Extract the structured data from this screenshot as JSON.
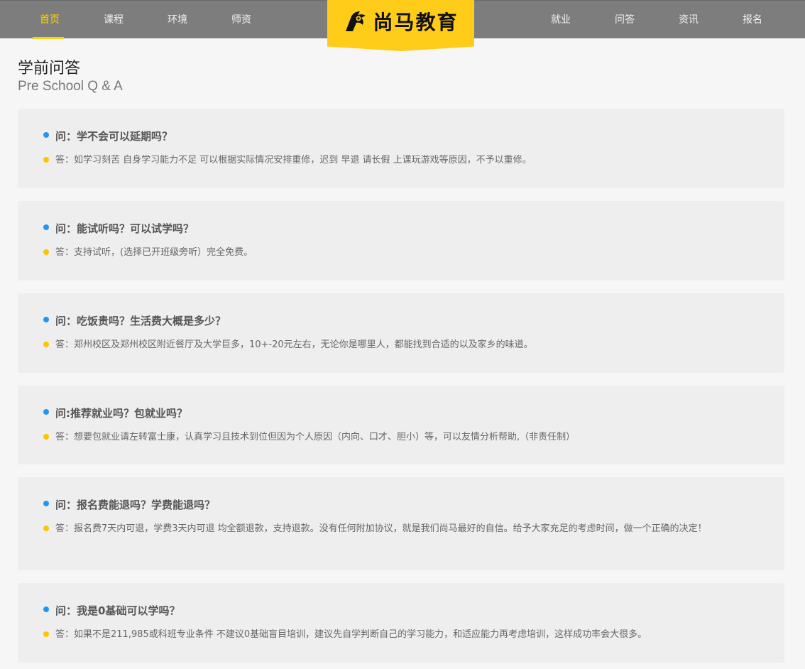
{
  "nav": {
    "left": [
      "首页",
      "课程",
      "环境",
      "师资"
    ],
    "right": [
      "就业",
      "问答",
      "资讯",
      "报名"
    ],
    "active": "首页"
  },
  "logo": {
    "text": "尚马教育",
    "icon": "horse-head-icon"
  },
  "colors": {
    "accent": "#ffd200",
    "question_dot": "#2196f3",
    "answer_dot": "#ffc400",
    "topbar": "#7d7d7d"
  },
  "page": {
    "title": "学前问答",
    "subtitle": "Pre School Q & A"
  },
  "qa": [
    {
      "question": "问：学不会可以延期吗？",
      "answer": "答：如学习刻苦 自身学习能力不足 可以根据实际情况安排重修，迟到 早退 请长假 上课玩游戏等原因，不予以重修。"
    },
    {
      "question": "问：能试听吗？可以试学吗？",
      "answer": "答：支持试听，(选择已开班级旁听）完全免费。"
    },
    {
      "question": "问：吃饭贵吗？生活费大概是多少？",
      "answer": "答：郑州校区及郑州校区附近餐厅及大学巨多，10+-20元左右，无论你是哪里人，都能找到合适的以及家乡的味道。"
    },
    {
      "question": "问:推荐就业吗？包就业吗？",
      "answer": "答：想要包就业请左转富士康，认真学习且技术到位但因为个人原因（内向、口才、胆小）等，可以友情分析帮助,（非责任制）"
    },
    {
      "question": "问：报名费能退吗？学费能退吗？",
      "answer": "答：报名费7天内可退，学费3天内可退 均全额退款，支持退款。没有任何附加协议，就是我们尚马最好的自信。给予大家充足的考虑时间，做一个正确的决定！"
    },
    {
      "question": "问：我是0基础可以学吗？",
      "answer": "答：如果不是211,985或科班专业条件 不建议0基础盲目培训，建议先自学判断自己的学习能力，和适应能力再考虑培训，这样成功率会大很多。"
    }
  ]
}
